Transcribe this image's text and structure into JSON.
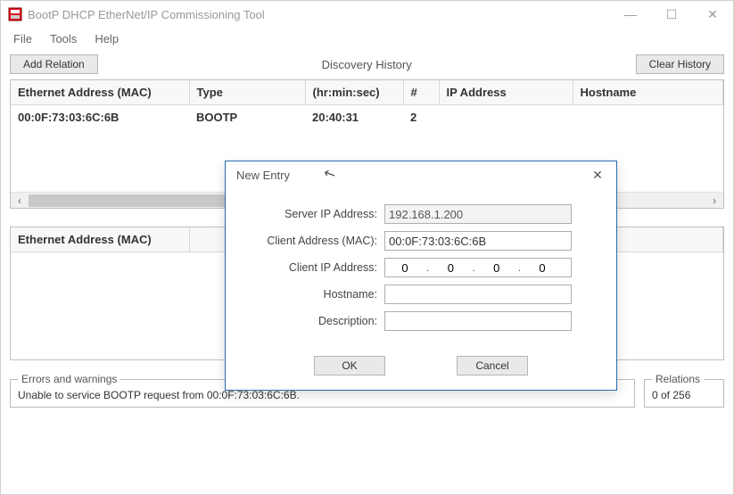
{
  "window": {
    "title": "BootP DHCP EtherNet/IP Commissioning Tool"
  },
  "menu": {
    "file": "File",
    "tools": "Tools",
    "help": "Help"
  },
  "toolbar": {
    "add_relation": "Add Relation",
    "clear_history": "Clear History",
    "discovery_title": "Discovery History"
  },
  "grid": {
    "headers": {
      "mac": "Ethernet Address (MAC)",
      "type": "Type",
      "time": "(hr:min:sec)",
      "count": "#",
      "ip": "IP Address",
      "host": "Hostname"
    },
    "row": {
      "mac": "00:0F:73:03:6C:6B",
      "type": "BOOTP",
      "time": "20:40:31",
      "count": "2",
      "ip": "",
      "host": ""
    }
  },
  "lower_grid": {
    "headers": {
      "mac": "Ethernet Address (MAC)"
    }
  },
  "status": {
    "errors_legend": "Errors and warnings",
    "errors_text": "Unable to service BOOTP request from 00:0F:73:03:6C:6B.",
    "relations_legend": "Relations",
    "relations_text": "0 of 256"
  },
  "dialog": {
    "title": "New Entry",
    "labels": {
      "server_ip": "Server IP Address:",
      "client_mac": "Client Address (MAC):",
      "client_ip": "Client IP Address:",
      "hostname": "Hostname:",
      "description": "Description:"
    },
    "values": {
      "server_ip": "192.168.1.200",
      "client_mac": "00:0F:73:03:6C:6B",
      "client_ip": {
        "a": "0",
        "b": "0",
        "c": "0",
        "d": "0"
      },
      "hostname": "",
      "description": ""
    },
    "buttons": {
      "ok": "OK",
      "cancel": "Cancel"
    }
  }
}
